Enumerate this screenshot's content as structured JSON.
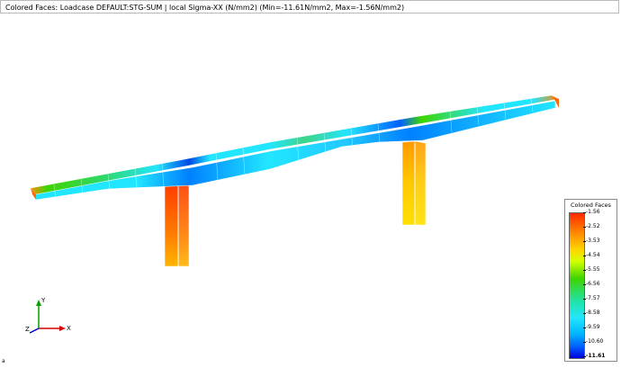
{
  "window": {
    "title": "Colored Faces: Loadcase DEFAULT:STG-SUM | local Sigma-XX (N/mm2) (Min=-11.61N/mm2, Max=-1.56N/mm2)"
  },
  "legend": {
    "title": "Colored Faces",
    "values": [
      "-1.56",
      "-2.52",
      "-3.53",
      "-4.54",
      "-5.55",
      "-6.56",
      "-7.57",
      "-8.58",
      "-9.59",
      "-10.60",
      "-11.61"
    ],
    "min_value": -11.61,
    "max_value": -1.56
  },
  "axes": {
    "x_label": "X",
    "y_label": "Y",
    "z_label": "Z",
    "x_color": "#d40000",
    "y_color": "#00a000",
    "z_color": "#0000d0"
  },
  "corner_mark": "a",
  "colors": {
    "red": "#ff2a00",
    "orange": "#ff8c00",
    "yellow": "#ffd400",
    "green": "#3fd400",
    "cyan": "#22e6ff",
    "blue": "#0000e0"
  }
}
